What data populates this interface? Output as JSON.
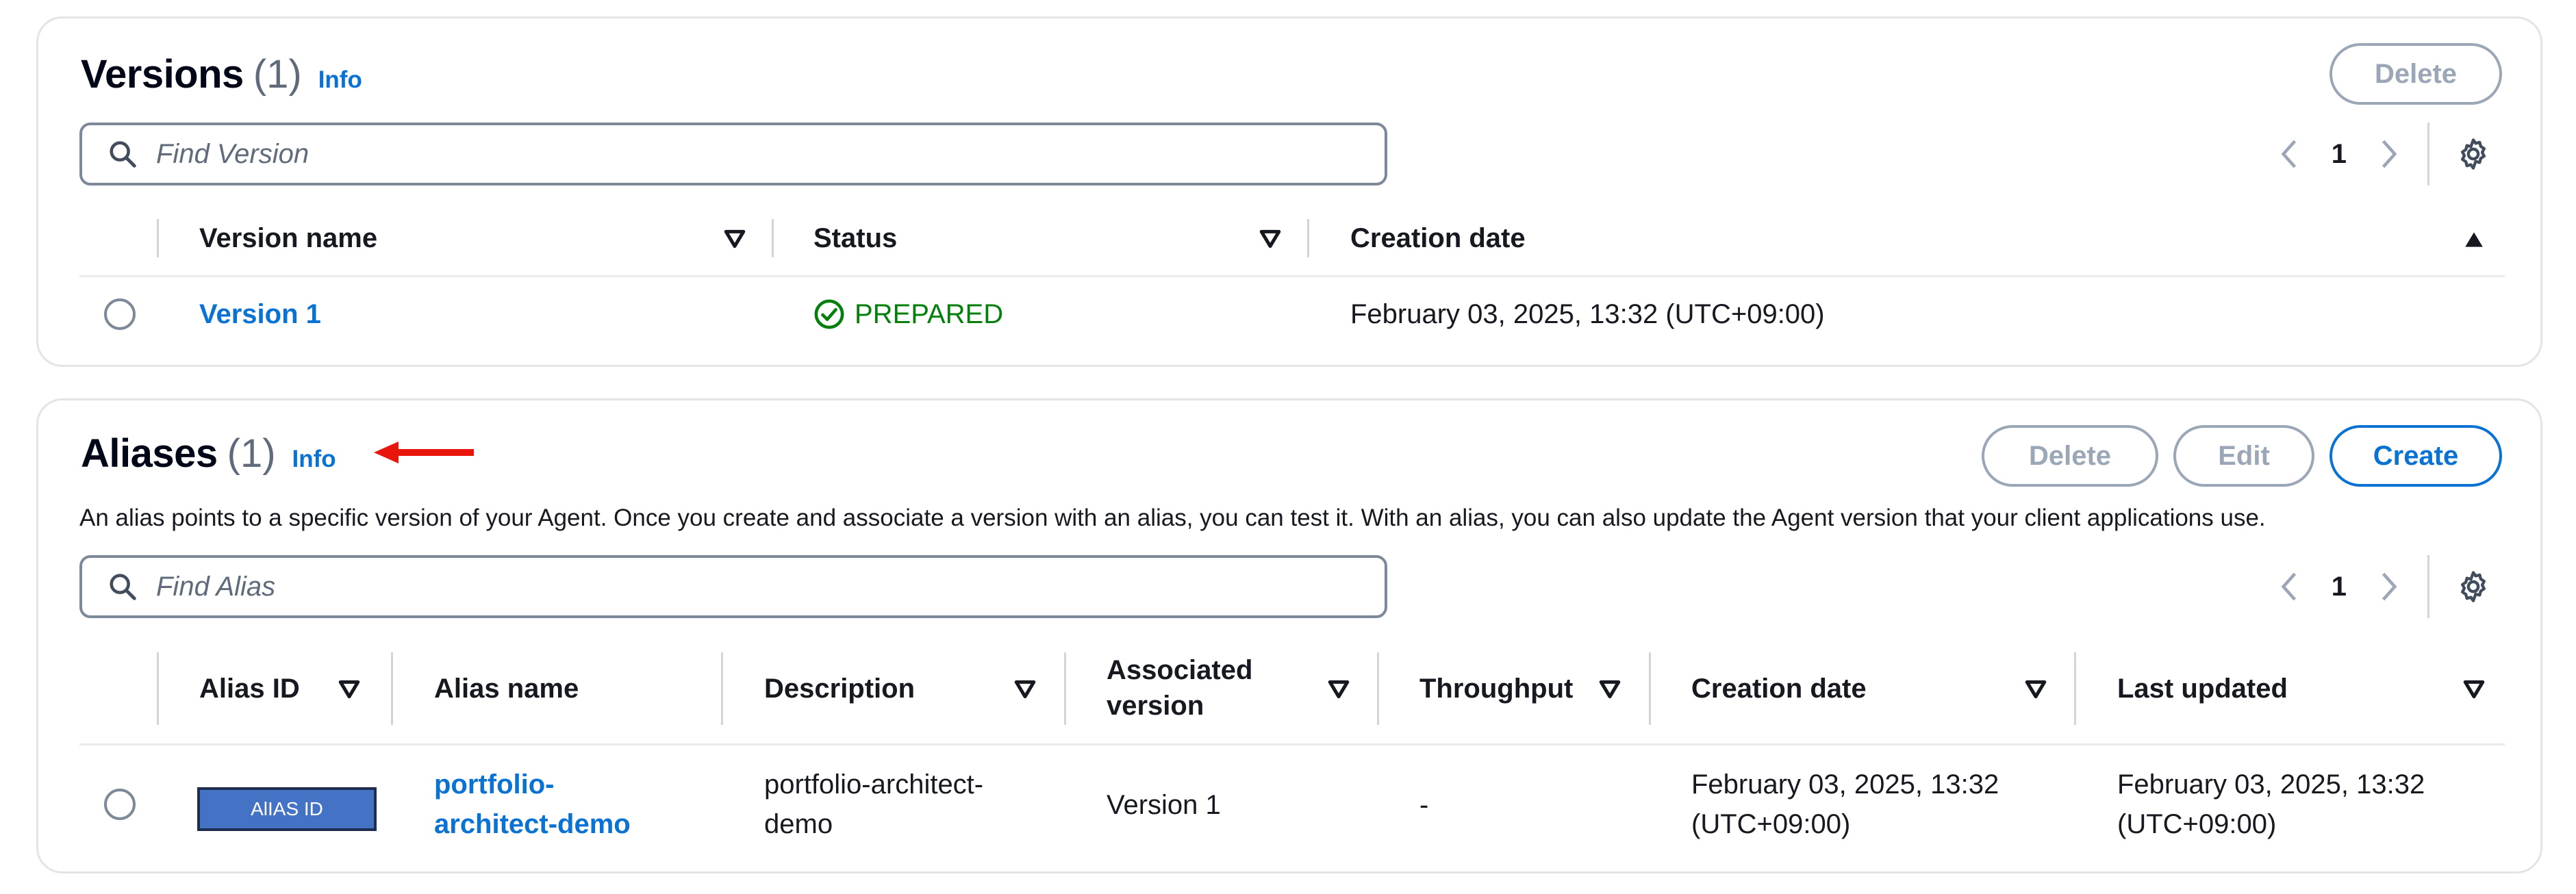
{
  "versions": {
    "title": "Versions",
    "count": "(1)",
    "info": "Info",
    "delete_label": "Delete",
    "search_placeholder": "Find Version",
    "page": "1",
    "columns": [
      "Version name",
      "Status",
      "Creation date"
    ],
    "rows": [
      {
        "name": "Version 1",
        "status": "PREPARED",
        "created": "February 03, 2025, 13:32 (UTC+09:00)"
      }
    ]
  },
  "aliases": {
    "title": "Aliases",
    "count": "(1)",
    "info": "Info",
    "delete_label": "Delete",
    "edit_label": "Edit",
    "create_label": "Create",
    "description": "An alias points to a specific version of your Agent. Once you create and associate a version with an alias, you can test it. With an alias, you can also update the Agent version that your client applications use.",
    "search_placeholder": "Find Alias",
    "page": "1",
    "columns": {
      "alias_id": "Alias ID",
      "alias_name": "Alias name",
      "description": "Description",
      "associated_1": "Associated",
      "associated_2": "version",
      "throughput": "Throughput",
      "creation_date": "Creation date",
      "last_updated": "Last updated"
    },
    "rows": [
      {
        "alias_id_badge": "AlIAS ID",
        "name_1": "portfolio-",
        "name_2": "architect-demo",
        "desc_1": "portfolio-architect-",
        "desc_2": "demo",
        "version": "Version 1",
        "throughput": "-",
        "created_1": "February 03, 2025, 13:32",
        "created_2": "(UTC+09:00)",
        "updated_1": "February 03, 2025, 13:32",
        "updated_2": "(UTC+09:00)"
      }
    ]
  },
  "colors": {
    "link": "#0972d3",
    "success": "#037f0c",
    "disabled": "#9ba7b6",
    "annotation_arrow": "#e8160c",
    "badge_fill": "#4472c4"
  }
}
